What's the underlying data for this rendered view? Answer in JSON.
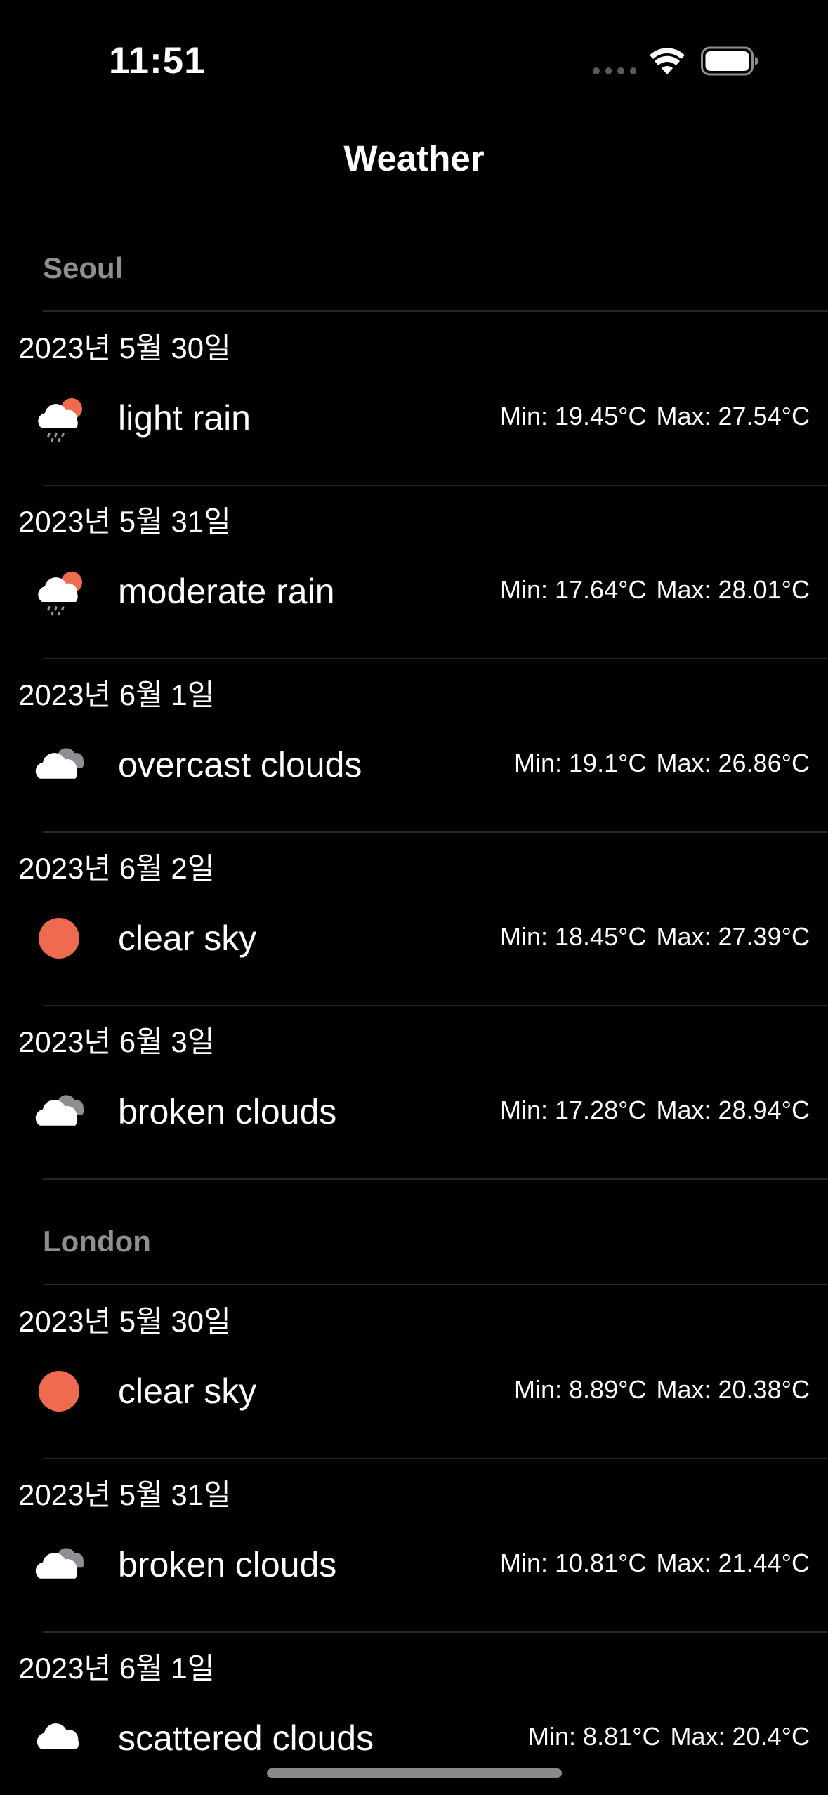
{
  "status_bar": {
    "time": "11:51"
  },
  "nav": {
    "title": "Weather"
  },
  "colors": {
    "sun": "#ef6b4f",
    "cloud_front": "#ffffff",
    "cloud_back": "#8e8e93",
    "section_header": "#8e8e93"
  },
  "sections": [
    {
      "city": "Seoul",
      "rows": [
        {
          "date": "2023년 5월 30일",
          "icon": "cloud-sun-rain-icon",
          "description": "light rain",
          "min": "Min: 19.45°C",
          "max": "Max: 27.54°C"
        },
        {
          "date": "2023년 5월 31일",
          "icon": "cloud-sun-rain-icon",
          "description": "moderate rain",
          "min": "Min: 17.64°C",
          "max": "Max: 28.01°C"
        },
        {
          "date": "2023년 6월 1일",
          "icon": "clouds-icon",
          "description": "overcast clouds",
          "min": "Min: 19.1°C",
          "max": "Max: 26.86°C"
        },
        {
          "date": "2023년 6월 2일",
          "icon": "sun-icon",
          "description": "clear sky",
          "min": "Min: 18.45°C",
          "max": "Max: 27.39°C"
        },
        {
          "date": "2023년 6월 3일",
          "icon": "clouds-icon",
          "description": "broken clouds",
          "min": "Min: 17.28°C",
          "max": "Max: 28.94°C"
        }
      ]
    },
    {
      "city": "London",
      "rows": [
        {
          "date": "2023년 5월 30일",
          "icon": "sun-icon",
          "description": "clear sky",
          "min": "Min: 8.89°C",
          "max": "Max: 20.38°C"
        },
        {
          "date": "2023년 5월 31일",
          "icon": "clouds-icon",
          "description": "broken clouds",
          "min": "Min: 10.81°C",
          "max": "Max: 21.44°C"
        },
        {
          "date": "2023년 6월 1일",
          "icon": "cloud-icon",
          "description": "scattered clouds",
          "min": "Min: 8.81°C",
          "max": "Max: 20.4°C"
        }
      ]
    }
  ]
}
